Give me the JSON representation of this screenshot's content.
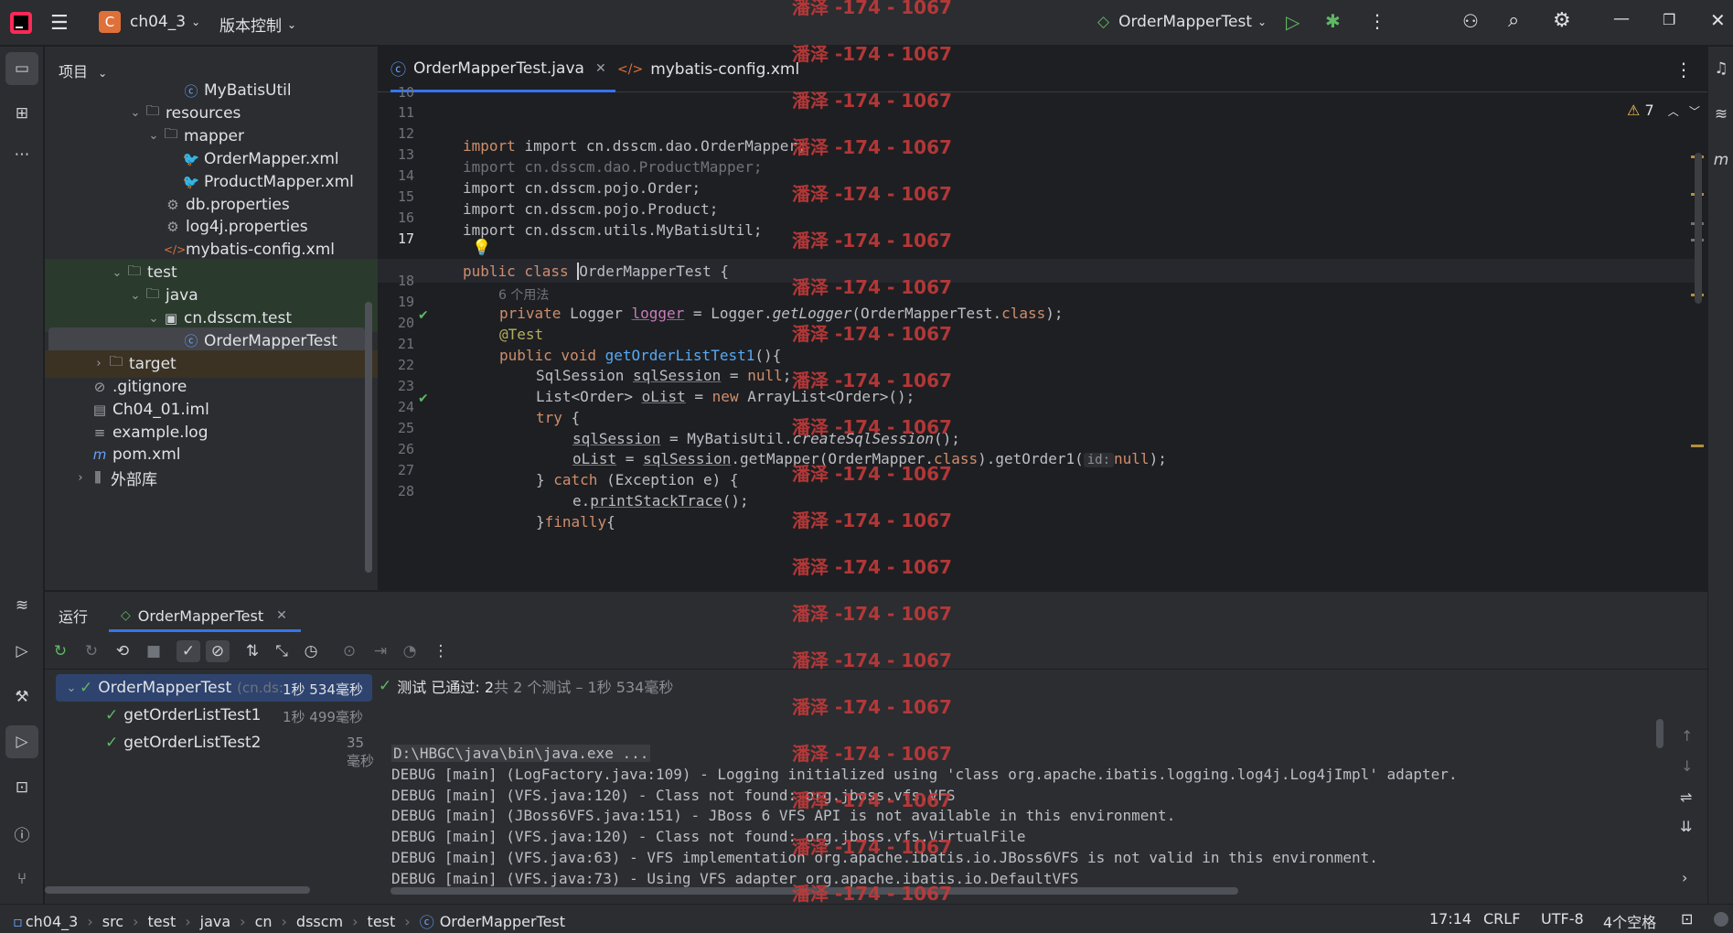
{
  "titlebar": {
    "project": "ch04_3",
    "project_badge": "C",
    "vcs": "版本控制",
    "run_config": "OrderMapperTest"
  },
  "project_panel": {
    "title": "项目",
    "items": [
      {
        "label": "MyBatisUtil",
        "icon": "class-icon",
        "depth": 7
      },
      {
        "label": "resources",
        "icon": "folder-icon",
        "depth": 4,
        "expanded": true
      },
      {
        "label": "mapper",
        "icon": "folder-icon",
        "depth": 5,
        "expanded": true
      },
      {
        "label": "OrderMapper.xml",
        "icon": "mybatis-xml-icon",
        "depth": 7
      },
      {
        "label": "ProductMapper.xml",
        "icon": "mybatis-xml-icon",
        "depth": 7
      },
      {
        "label": "db.properties",
        "icon": "properties-icon",
        "depth": 6
      },
      {
        "label": "log4j.properties",
        "icon": "properties-icon",
        "depth": 6
      },
      {
        "label": "mybatis-config.xml",
        "icon": "xml-icon",
        "depth": 6
      },
      {
        "label": "test",
        "icon": "folder-icon",
        "depth": 3,
        "expanded": true
      },
      {
        "label": "java",
        "icon": "folder-icon",
        "depth": 4,
        "expanded": true
      },
      {
        "label": "cn.dsscm.test",
        "icon": "package-icon",
        "depth": 5,
        "expanded": true
      },
      {
        "label": "OrderMapperTest",
        "icon": "class-icon",
        "depth": 7,
        "selected": true
      },
      {
        "label": "target",
        "icon": "folder-icon",
        "depth": 2,
        "expanded": false
      },
      {
        "label": ".gitignore",
        "icon": "gitignore-icon",
        "depth": 2
      },
      {
        "label": "Ch04_01.iml",
        "icon": "iml-icon",
        "depth": 2
      },
      {
        "label": "example.log",
        "icon": "log-icon",
        "depth": 2
      },
      {
        "label": "pom.xml",
        "icon": "maven-icon",
        "depth": 2
      },
      {
        "label": "外部库",
        "icon": "library-icon",
        "depth": 1,
        "expanded": false
      }
    ]
  },
  "editor": {
    "tabs": [
      {
        "label": "OrderMapperTest.java",
        "active": true
      },
      {
        "label": "mybatis-config.xml",
        "active": false
      }
    ],
    "warnings": "7",
    "line_numbers": [
      "10",
      "11",
      "12",
      "13",
      "14",
      "15",
      "16",
      "17",
      "",
      "18",
      "19",
      "20",
      "21",
      "22",
      "23",
      "24",
      "25",
      "26",
      "27",
      "28"
    ],
    "code": {
      "l11": "import cn.dsscm.dao.OrderMapper;",
      "l12": "import cn.dsscm.dao.ProductMapper;",
      "l13": "import cn.dsscm.pojo.Order;",
      "l14": "import cn.dsscm.pojo.Product;",
      "l15": "import cn.dsscm.utils.MyBatisUtil;",
      "l17_kw": "public class ",
      "l17_name": "OrderMapperTest",
      "l17_rest": " {",
      "usages": "6 个用法",
      "l18_kw": "private ",
      "l18_a": "Logger ",
      "l18_b": "logger",
      "l18_c": " = Logger.",
      "l18_d": "getLogger",
      "l18_e": "(OrderMapperTest.",
      "l18_f": "class",
      "l18_g": ");",
      "l19": "@Test",
      "l20_kw": "public void ",
      "l20_fn": "getOrderListTest1",
      "l20_rest": "(){",
      "l21_a": "SqlSession ",
      "l21_b": "sqlSession",
      "l21_c": " = ",
      "l21_d": "null",
      "l21_e": ";",
      "l22_a": "List<Order> ",
      "l22_b": "oList",
      "l22_c": " = ",
      "l22_d": "new ",
      "l22_e": "ArrayList<Order>();",
      "l23_kw": "try",
      "l23_rest": " {",
      "l24_a": "sqlSession",
      "l24_b": " = MyBatisUtil.",
      "l24_c": "createSqlSession",
      "l24_d": "();",
      "l25_a": "oList",
      "l25_b": " = ",
      "l25_c": "sqlSession",
      "l25_d": ".getMapper(OrderMapper.",
      "l25_e": "class",
      "l25_f": ").getOrder1(",
      "l25_hint": "id:",
      "l25_g": "null",
      "l25_h": ");",
      "l26_a": "} ",
      "l26_kw": "catch",
      "l26_b": " (Exception e) {",
      "l27_a": "e.",
      "l27_b": "printStackTrace",
      "l27_c": "();",
      "l28_a": "}",
      "l28_kw": "finally",
      "l28_b": "{"
    }
  },
  "run_panel": {
    "title": "运行",
    "tab": "OrderMapperTest",
    "tests": [
      {
        "label": "OrderMapperTest",
        "sub": "(cn.ds:",
        "duration": "1秒 534毫秒"
      },
      {
        "label": "getOrderListTest1",
        "duration": "1秒 499毫秒"
      },
      {
        "label": "getOrderListTest2",
        "duration": "35毫秒"
      }
    ],
    "status_bold": "测试 已通过: 2",
    "status_rest": "共 2 个测试 – 1秒 534毫秒",
    "console": [
      "D:\\HBGC\\java\\bin\\java.exe ...",
      "DEBUG [main] (LogFactory.java:109) - Logging initialized using 'class org.apache.ibatis.logging.log4j.Log4jImpl' adapter.",
      "DEBUG [main] (VFS.java:120) - Class not found: org.jboss.vfs.VFS",
      "DEBUG [main] (JBoss6VFS.java:151) - JBoss 6 VFS API is not available in this environment.",
      "DEBUG [main] (VFS.java:120) - Class not found: org.jboss.vfs.VirtualFile",
      "DEBUG [main] (VFS.java:63) - VFS implementation org.apache.ibatis.io.JBoss6VFS is not valid in this environment.",
      "DEBUG [main] (VFS.java:73) - Using VFS adapter org.apache.ibatis.io.DefaultVFS"
    ]
  },
  "breadcrumb": [
    "ch04_3",
    "src",
    "test",
    "java",
    "cn",
    "dsscm",
    "test",
    "OrderMapperTest"
  ],
  "statusbar": {
    "position": "17:14",
    "line_sep": "CRLF",
    "encoding": "UTF-8",
    "indent": "4个空格"
  },
  "watermark": "潘泽 -174 - 1067",
  "colors": {
    "accent": "#3574f0",
    "pass": "#5fb865",
    "keyword": "#cf8e6d",
    "function": "#56a8f5",
    "watermark": "#c33a3a"
  }
}
